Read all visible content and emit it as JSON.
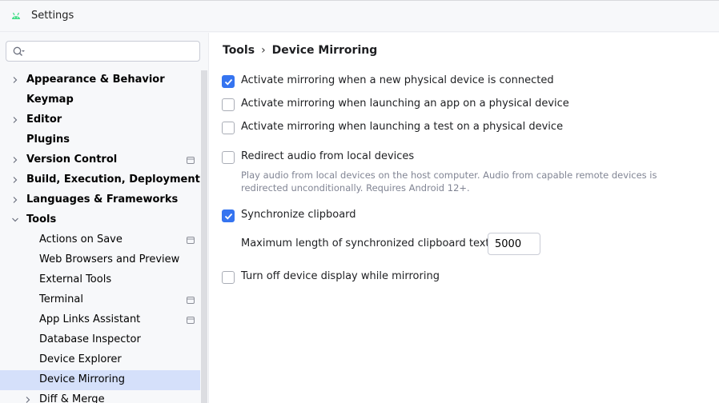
{
  "window": {
    "title": "Settings",
    "icon": "android-icon"
  },
  "search": {
    "placeholder": "",
    "value": ""
  },
  "tree": [
    {
      "label": "Appearance & Behavior",
      "bold": true,
      "chevron": "right",
      "indent": 0
    },
    {
      "label": "Keymap",
      "bold": true,
      "chevron": null,
      "indent": 0
    },
    {
      "label": "Editor",
      "bold": true,
      "chevron": "right",
      "indent": 0
    },
    {
      "label": "Plugins",
      "bold": true,
      "chevron": null,
      "indent": 0
    },
    {
      "label": "Version Control",
      "bold": true,
      "chevron": "right",
      "indent": 0,
      "project_icon": true
    },
    {
      "label": "Build, Execution, Deployment",
      "bold": true,
      "chevron": "right",
      "indent": 0
    },
    {
      "label": "Languages & Frameworks",
      "bold": true,
      "chevron": "right",
      "indent": 0
    },
    {
      "label": "Tools",
      "bold": true,
      "chevron": "down",
      "indent": 0
    },
    {
      "label": "Actions on Save",
      "bold": false,
      "chevron": null,
      "indent": 1,
      "project_icon": true
    },
    {
      "label": "Web Browsers and Preview",
      "bold": false,
      "chevron": null,
      "indent": 1
    },
    {
      "label": "External Tools",
      "bold": false,
      "chevron": null,
      "indent": 1
    },
    {
      "label": "Terminal",
      "bold": false,
      "chevron": null,
      "indent": 1,
      "project_icon": true
    },
    {
      "label": "App Links Assistant",
      "bold": false,
      "chevron": null,
      "indent": 1,
      "project_icon": true
    },
    {
      "label": "Database Inspector",
      "bold": false,
      "chevron": null,
      "indent": 1
    },
    {
      "label": "Device Explorer",
      "bold": false,
      "chevron": null,
      "indent": 1
    },
    {
      "label": "Device Mirroring",
      "bold": false,
      "chevron": null,
      "indent": 1,
      "selected": true
    },
    {
      "label": "Diff & Merge",
      "bold": false,
      "chevron": "right",
      "indent": 1
    }
  ],
  "breadcrumb": {
    "parent": "Tools",
    "separator": "›",
    "current": "Device Mirroring"
  },
  "options": {
    "activate_connected": {
      "label": "Activate mirroring when a new physical device is connected",
      "checked": true
    },
    "activate_app": {
      "label": "Activate mirroring when launching an app on a physical device",
      "checked": false
    },
    "activate_test": {
      "label": "Activate mirroring when launching a test on a physical device",
      "checked": false
    },
    "redirect_audio": {
      "label": "Redirect audio from local devices",
      "checked": false,
      "description_line1": "Play audio from local devices on the host computer. Audio from capable remote devices is",
      "description_line2": "redirected unconditionally. Requires Android 12+."
    },
    "sync_clipboard": {
      "label": "Synchronize clipboard",
      "checked": true
    },
    "max_length": {
      "label": "Maximum length of synchronized clipboard text:",
      "value": "5000"
    },
    "turn_off_display": {
      "label": "Turn off device display while mirroring",
      "checked": false
    }
  },
  "colors": {
    "accent": "#3574f0",
    "selection": "#d5e0fa",
    "sidebar_bg": "#f7f8fa",
    "muted_text": "#818594"
  }
}
